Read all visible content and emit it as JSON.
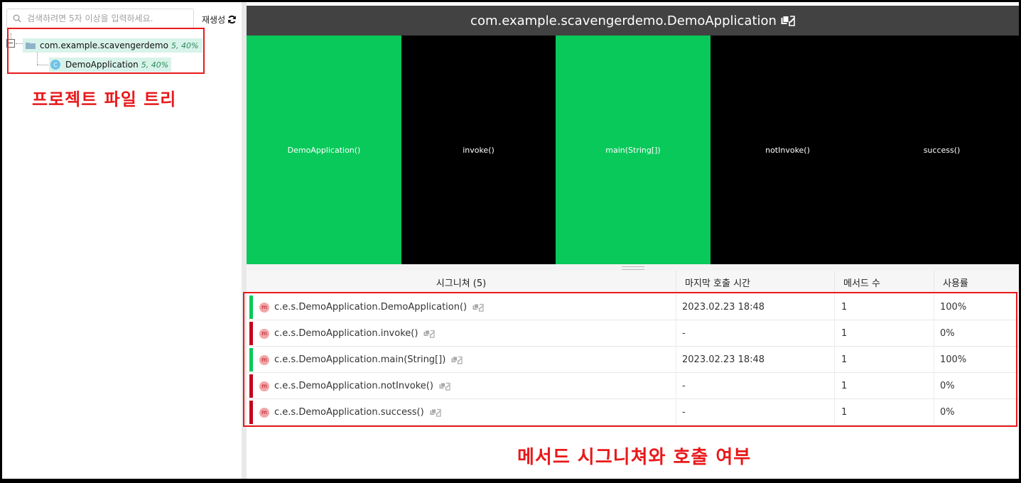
{
  "sidebar": {
    "search": {
      "placeholder": "검색하려면 5자 이상을 입력하세요.",
      "value": ""
    },
    "regen_label": "재생성",
    "tree": {
      "package": {
        "label": "com.example.scavengerdemo",
        "stat": "5, 40%"
      },
      "class": {
        "label": "DemoApplication",
        "stat": "5, 40%",
        "icon_letter": "C"
      }
    },
    "annotation": "프로젝트 파일 트리"
  },
  "main": {
    "title": "com.example.scavengerdemo.DemoApplication",
    "treemap": [
      {
        "label": "DemoApplication()",
        "color": "#09c95a"
      },
      {
        "label": "invoke()",
        "color": "#000000"
      },
      {
        "label": "main(String[])",
        "color": "#09c95a"
      },
      {
        "label": "notInvoke()",
        "color": "#000000"
      },
      {
        "label": "success()",
        "color": "#000000"
      }
    ],
    "table": {
      "headers": {
        "signature": "시그니쳐 (5)",
        "last_call": "마지막 호출 시간",
        "method_count": "메서드 수",
        "usage": "사용률"
      },
      "rows": [
        {
          "badge": "m",
          "signature": "c.e.s.DemoApplication.DemoApplication()",
          "last_call": "2023.02.23 18:48",
          "method_count": "1",
          "usage": "100%",
          "status": "green"
        },
        {
          "badge": "m",
          "signature": "c.e.s.DemoApplication.invoke()",
          "last_call": "-",
          "method_count": "1",
          "usage": "0%",
          "status": "red"
        },
        {
          "badge": "m",
          "signature": "c.e.s.DemoApplication.main(String[])",
          "last_call": "2023.02.23 18:48",
          "method_count": "1",
          "usage": "100%",
          "status": "green"
        },
        {
          "badge": "m",
          "signature": "c.e.s.DemoApplication.notInvoke()",
          "last_call": "-",
          "method_count": "1",
          "usage": "0%",
          "status": "red"
        },
        {
          "badge": "m",
          "signature": "c.e.s.DemoApplication.success()",
          "last_call": "-",
          "method_count": "1",
          "usage": "0%",
          "status": "red"
        }
      ]
    },
    "annotation": "메서드 시그니쳐와 호출 여부"
  },
  "colors": {
    "used": "#09c95a",
    "unused": "#c3051d",
    "annotation": "#e8191b",
    "header_bg": "#424242"
  },
  "icons": {
    "search": "search-icon",
    "refresh": "refresh-icon",
    "copy": "copy-icon",
    "edit": "edit-icon",
    "folder": "folder-icon"
  }
}
